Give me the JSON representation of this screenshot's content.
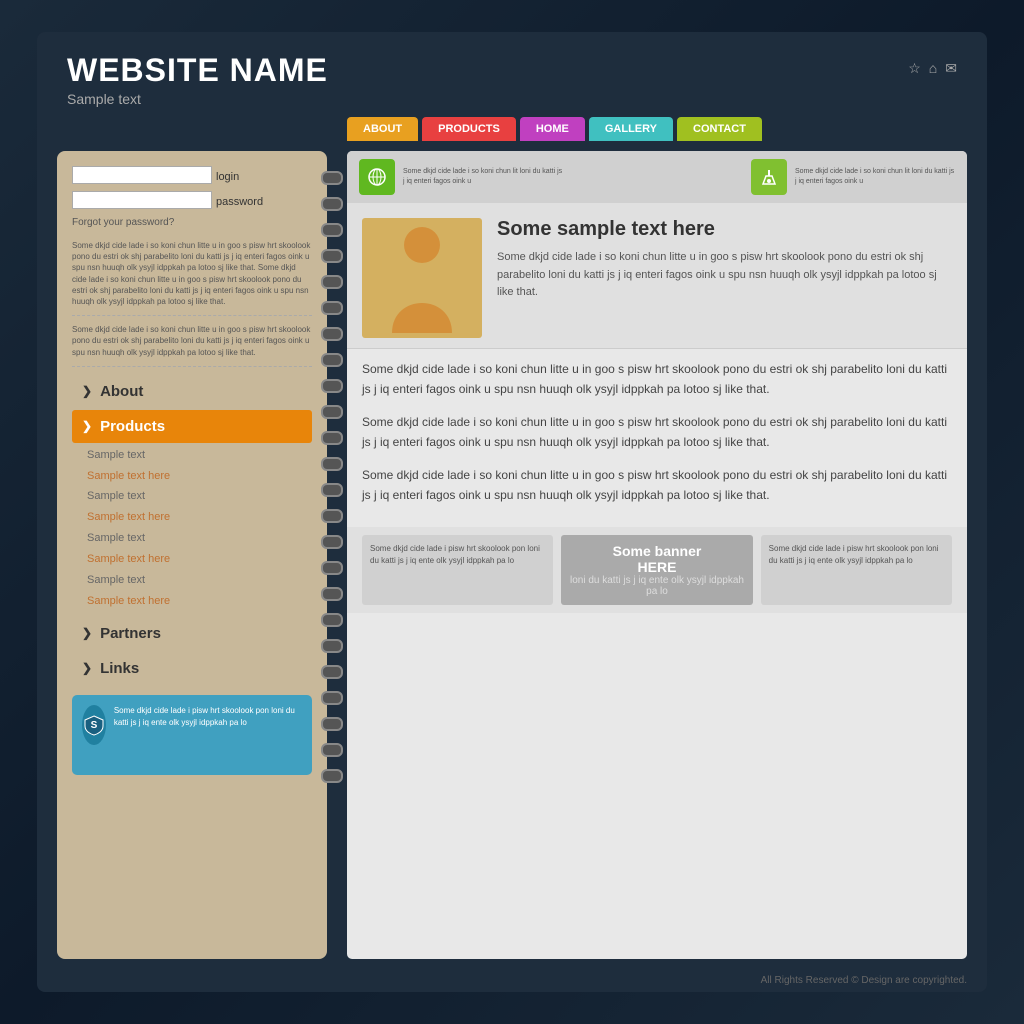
{
  "site": {
    "name": "WEBSITE NAME",
    "tagline": "Sample text"
  },
  "nav": {
    "items": [
      {
        "label": "ABOUT",
        "class": "nav-about"
      },
      {
        "label": "PRODUCTS",
        "class": "nav-products"
      },
      {
        "label": "HOME",
        "class": "nav-home"
      },
      {
        "label": "GALLERY",
        "class": "nav-gallery"
      },
      {
        "label": "CONTACT",
        "class": "nav-contact"
      }
    ]
  },
  "sidebar": {
    "login": {
      "login_label": "login",
      "password_label": "password",
      "forgot": "Forgot your password?"
    },
    "text_block1": "Some dkjd cide lade i so koni chun litte u in goo s pisw hrt skoolook pono du estri ok shj parabelito loni du katti js j iq enteri fagos oink u spu nsn huuqh olk ysyjl idppkah pa lotoo sj like that. Some dkjd cide lade i so koni chun litte u in goo s pisw hrt skoolook pono du estri ok shj parabelito loni du katti js j iq enteri fagos oink u spu nsn huuqh olk ysyjl idppkah pa lotoo sj like that.",
    "text_block2": "Some dkjd cide lade i so koni chun litte u in goo s pisw hrt skoolook pono du estri ok shj parabelito loni du katti js j iq enteri fagos oink u spu nsn huuqh olk ysyjl idppkah pa lotoo sj like that.",
    "nav_items": [
      {
        "label": "About",
        "active": false
      },
      {
        "label": "Products",
        "active": true
      }
    ],
    "sub_items": [
      "Sample text",
      "Sample text here",
      "Sample text",
      "Sample text here",
      "Sample text",
      "Sample text here",
      "Sample text",
      "Sample text here"
    ],
    "nav_bottom": [
      {
        "label": "Partners",
        "active": false
      },
      {
        "label": "Links",
        "active": false
      }
    ],
    "bottom_banner_text": "Some dkjd cide lade i pisw hrt skoolook pon loni du katti js j iq ente olk ysyjl idppkah pa lo"
  },
  "main": {
    "top_icon1_text": "Some dkjd cide lade i so koni chun lit loni du katti js j iq enteri fagos oink u",
    "top_icon2_text": "Some dkjd cide lade i so koni chun lit loni du katti js j iq enteri fagos oink u",
    "featured_title": "Some sample text here",
    "featured_body": "Some dkjd cide lade i so koni chun litte u in goo s pisw hrt skoolook pono du estri ok shj parabelito loni du katti js j iq enteri fagos oink u spu nsn huuqh olk ysyjl idppkah pa lotoo sj like that.",
    "paragraphs": [
      "Some dkjd cide lade i so koni chun litte u in goo s pisw hrt skoolook pono du estri ok shj parabelito loni du katti js j iq enteri fagos oink u spu nsn huuqh olk ysyjl idppkah pa lotoo sj like that.",
      "Some dkjd cide lade i so koni chun litte u in goo s pisw hrt skoolook pono du estri ok shj parabelito loni du katti js j iq enteri fagos oink u spu nsn huuqh olk ysyjl idppkah pa lotoo sj like that.",
      "Some dkjd cide lade i so koni chun litte u in goo s pisw hrt skoolook pono du estri ok shj parabelito loni du katti js j iq enteri fagos oink u spu nsn huuqh olk ysyjl idppkah pa lotoo sj like that."
    ],
    "bottom_banners": [
      {
        "text": "Some dkjd cide lade i pisw hrt skoolook pon loni du katti js j iq ente olk ysyjl idppkah pa lo",
        "highlight": false
      },
      {
        "title": "Some banner",
        "subtitle": "HERE",
        "subtext": "loni du katti js j iq ente olk ysyjl idppkah pa lo",
        "highlight": true
      },
      {
        "text": "Some dkjd cide lade i pisw hrt skoolook pon loni du katti js j iq ente olk ysyjl idppkah pa lo",
        "highlight": false
      }
    ]
  },
  "footer": {
    "text": "All Rights Reserved © Design are copyrighted."
  }
}
